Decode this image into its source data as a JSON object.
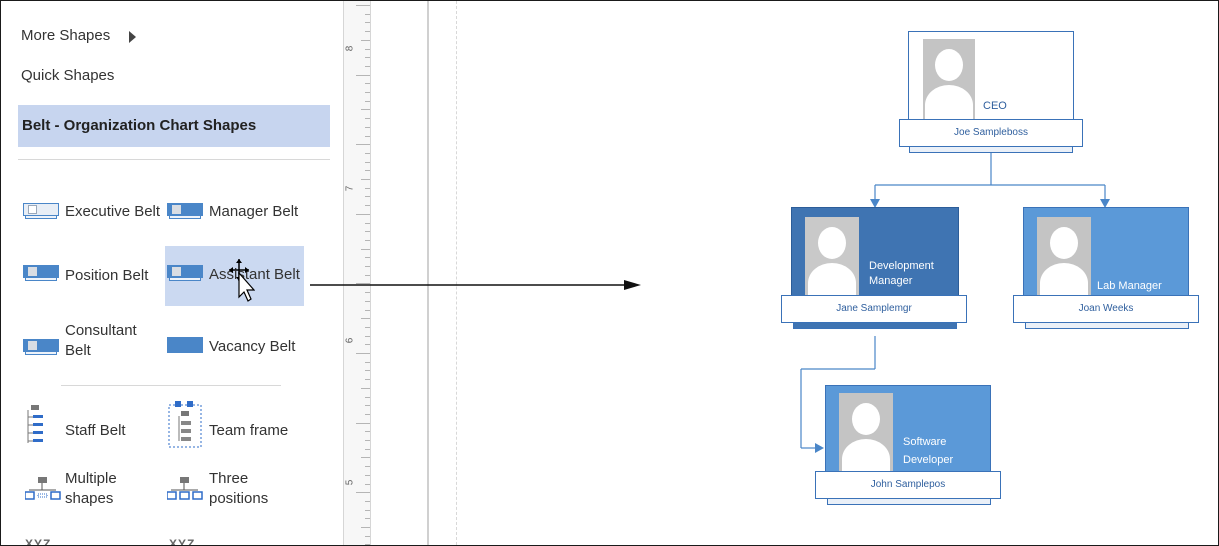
{
  "panel": {
    "more_shapes": "More Shapes",
    "quick_shapes": "Quick Shapes",
    "stencil_title": "Belt - Organization Chart Shapes",
    "shapes": {
      "executive_belt": "Executive Belt",
      "manager_belt": "Manager Belt",
      "position_belt": "Position Belt",
      "assistant_belt": "Assistant Belt",
      "consultant_belt_line1": "Consultant",
      "consultant_belt_line2": "Belt",
      "vacancy_belt": "Vacancy Belt",
      "staff_belt": "Staff Belt",
      "team_frame": "Team frame",
      "multiple_shapes_line1": "Multiple",
      "multiple_shapes_line2": "shapes",
      "three_positions_line1": "Three",
      "three_positions_line2": "positions",
      "xyz_1": "XYZ",
      "xyz_2": "XYZ"
    }
  },
  "ruler": {
    "labels": [
      "8",
      "7",
      "6",
      "5"
    ]
  },
  "org_chart": {
    "ceo": {
      "title": "CEO",
      "name": "Joe Sampleboss"
    },
    "dev_manager": {
      "title_line1": "Development",
      "title_line2": "Manager",
      "name": "Jane Samplemgr"
    },
    "lab_manager": {
      "title": "Lab Manager",
      "name": "Joan Weeks"
    },
    "software_dev": {
      "title_line1": "Software",
      "title_line2": "Developer",
      "name": "John Samplepos"
    }
  },
  "colors": {
    "accent": "#4a86c8",
    "selected_dark": "#3f74b2",
    "box_light": "#5b99d8",
    "header_highlight": "#c7d5ef"
  }
}
